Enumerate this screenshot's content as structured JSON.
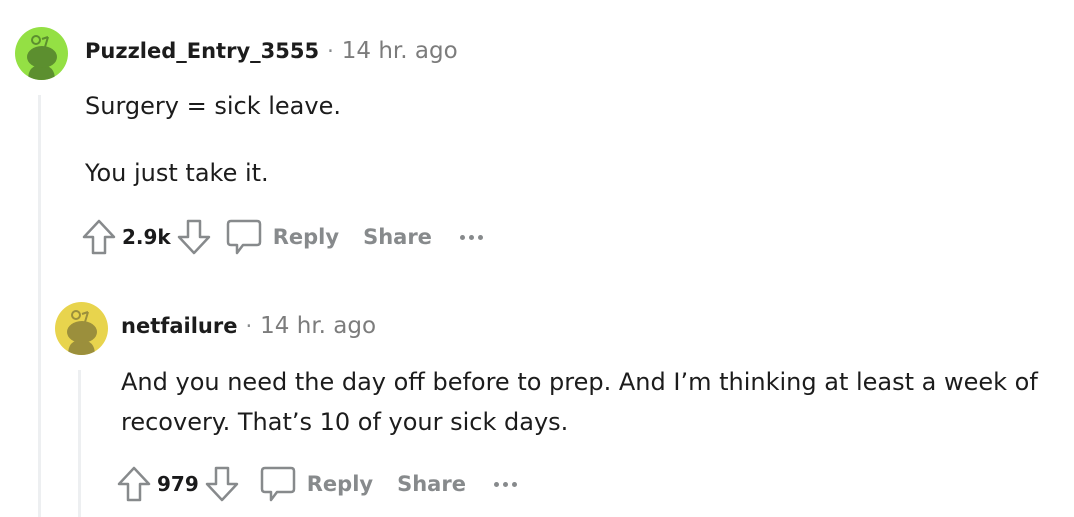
{
  "comments": [
    {
      "username": "Puzzled_Entry_3555",
      "separator": "·",
      "time": "14 hr. ago",
      "avatar_color": "#94e044",
      "avatar_figure_color": "#5c8f2f",
      "paragraphs": [
        "Surgery = sick leave.",
        "You just take it."
      ],
      "score": "2.9k",
      "actions": {
        "reply": "Reply",
        "share": "Share"
      }
    },
    {
      "username": "netfailure",
      "separator": "·",
      "time": "14 hr. ago",
      "avatar_color": "#e8d44d",
      "avatar_figure_color": "#9b8f3c",
      "paragraphs": [
        "And you need the day off before to prep. And I’m thinking at least a week of recovery. That’s 10 of your sick days."
      ],
      "score": "979",
      "actions": {
        "reply": "Reply",
        "share": "Share"
      }
    }
  ]
}
